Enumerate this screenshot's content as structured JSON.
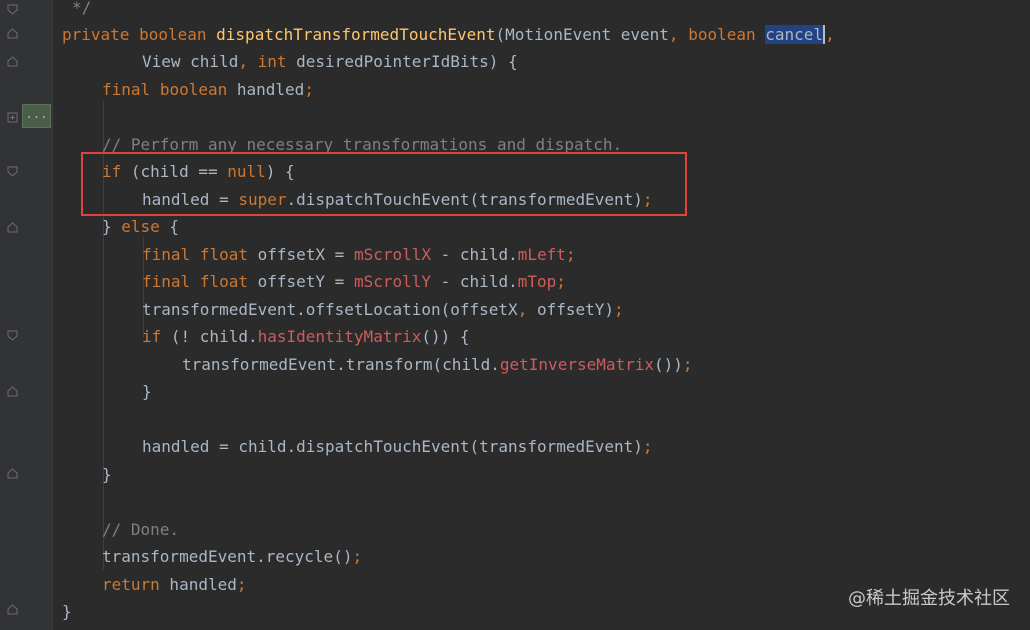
{
  "editor": {
    "lines": {
      "l0": {
        "text": "*/"
      },
      "l1": {
        "t1": "private",
        "t2": " ",
        "t3": "boolean",
        "t4": " ",
        "t5": "dispatchTransformedTouchEvent",
        "t6": "(MotionEvent event",
        "t7": ",",
        "t8": " ",
        "t9": "boolean",
        "t10": " ",
        "t11": "cancel",
        "t12": ","
      },
      "l2": {
        "t1": "View child",
        "t2": ",",
        "t3": " ",
        "t4": "int",
        "t5": " desiredPointerIdBits) {"
      },
      "l3": {
        "t1": "final",
        "t2": " ",
        "t3": "boolean",
        "t4": " handled",
        "t5": ";"
      },
      "l5": {
        "text": "// Perform any necessary transformations and dispatch."
      },
      "l6": {
        "t1": "if",
        "t2": " (child == ",
        "t3": "null",
        "t4": ") {"
      },
      "l7": {
        "t1": "handled = ",
        "t2": "super",
        "t3": ".dispatchTouchEvent(transformedEvent)",
        "t4": ";"
      },
      "l8": {
        "t1": "} ",
        "t2": "else",
        "t3": " {"
      },
      "l9": {
        "t1": "final",
        "t2": " ",
        "t3": "float",
        "t4": " offsetX = ",
        "t5": "mScrollX",
        "t6": " - child.",
        "t7": "mLeft",
        "t8": ";"
      },
      "l10": {
        "t1": "final",
        "t2": " ",
        "t3": "float",
        "t4": " offsetY = ",
        "t5": "mScrollY",
        "t6": " - child.",
        "t7": "mTop",
        "t8": ";"
      },
      "l11": {
        "t1": "transformedEvent.offsetLocation(offsetX",
        "t2": ",",
        "t3": " offsetY)",
        "t4": ";"
      },
      "l12": {
        "t1": "if",
        "t2": " (! child.",
        "t3": "hasIdentityMatrix",
        "t4": "()) {"
      },
      "l13": {
        "t1": "transformedEvent.transform(child.",
        "t2": "getInverseMatrix",
        "t3": "())",
        "t4": ";"
      },
      "l14": {
        "text": "}"
      },
      "l16": {
        "t1": "handled = child.dispatchTouchEvent(transformedEvent)",
        "t2": ";"
      },
      "l17": {
        "text": "}"
      },
      "l19": {
        "text": "// Done."
      },
      "l20": {
        "t1": "transformedEvent.recycle()",
        "t2": ";"
      },
      "l21": {
        "t1": "return",
        "t2": " handled",
        "t3": ";"
      },
      "l22": {
        "text": "}"
      }
    },
    "collapsed_badge": "..."
  },
  "watermark": "@稀土掘金技术社区",
  "colors": {
    "background": "#2b2b2b",
    "keyword": "#cc7832",
    "method": "#ffc66d",
    "field": "#cf5c59",
    "comment": "#808080",
    "text": "#a9b7c6",
    "selection": "#214283",
    "highlight_box": "#e0423e"
  },
  "icons": {
    "fold": "fold-marker-icon",
    "fold_collapsed": "fold-collapsed-icon"
  }
}
